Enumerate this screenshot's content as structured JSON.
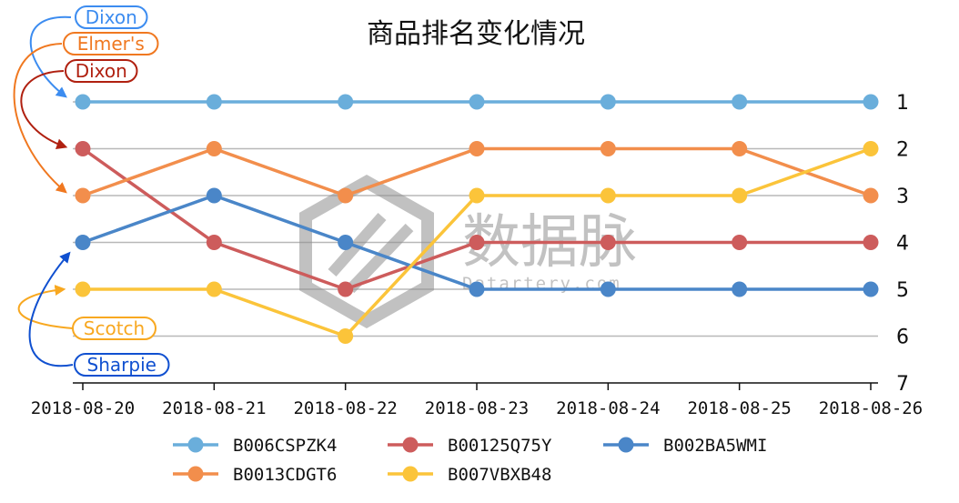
{
  "chart_data": {
    "type": "line",
    "title": "商品排名变化情况",
    "xlabel": "",
    "ylabel": "",
    "categories": [
      "2018-08-20",
      "2018-08-21",
      "2018-08-22",
      "2018-08-23",
      "2018-08-24",
      "2018-08-25",
      "2018-08-26"
    ],
    "yticks": [
      "1",
      "2",
      "3",
      "4",
      "5",
      "6",
      "7"
    ],
    "ylim": [
      7,
      1
    ],
    "y_inverted": true,
    "y_axis_side": "right",
    "grid": "horizontal",
    "legend_position": "bottom",
    "series": [
      {
        "name": "B006CSPZK4",
        "color": "#6aaedb",
        "values": [
          1,
          1,
          1,
          1,
          1,
          1,
          1
        ]
      },
      {
        "name": "B00125Q75Y",
        "color": "#cd5c5c",
        "values": [
          2,
          4,
          5,
          4,
          4,
          4,
          4
        ]
      },
      {
        "name": "B002BA5WMI",
        "color": "#4a86c8",
        "values": [
          4,
          3,
          4,
          5,
          5,
          5,
          5
        ]
      },
      {
        "name": "B0013CDGT6",
        "color": "#f28e4c",
        "values": [
          3,
          2,
          3,
          2,
          2,
          2,
          3
        ]
      },
      {
        "name": "B007VBXB48",
        "color": "#fbc43a",
        "values": [
          5,
          5,
          6,
          3,
          3,
          3,
          2
        ]
      }
    ],
    "annotations": [
      {
        "text": "Dixon",
        "color": "#3c8cf0",
        "target_rank": 1
      },
      {
        "text": "Elmer's",
        "color": "#f07820",
        "target_rank": 3
      },
      {
        "text": "Dixon",
        "color": "#b02010",
        "target_rank": 2
      },
      {
        "text": "Scotch",
        "color": "#f8a820",
        "target_rank": 5
      },
      {
        "text": "Sharpie",
        "color": "#1050d0",
        "target_rank": 4
      }
    ]
  },
  "watermark": {
    "main": "数据脉",
    "sub": "Datartery.com"
  }
}
